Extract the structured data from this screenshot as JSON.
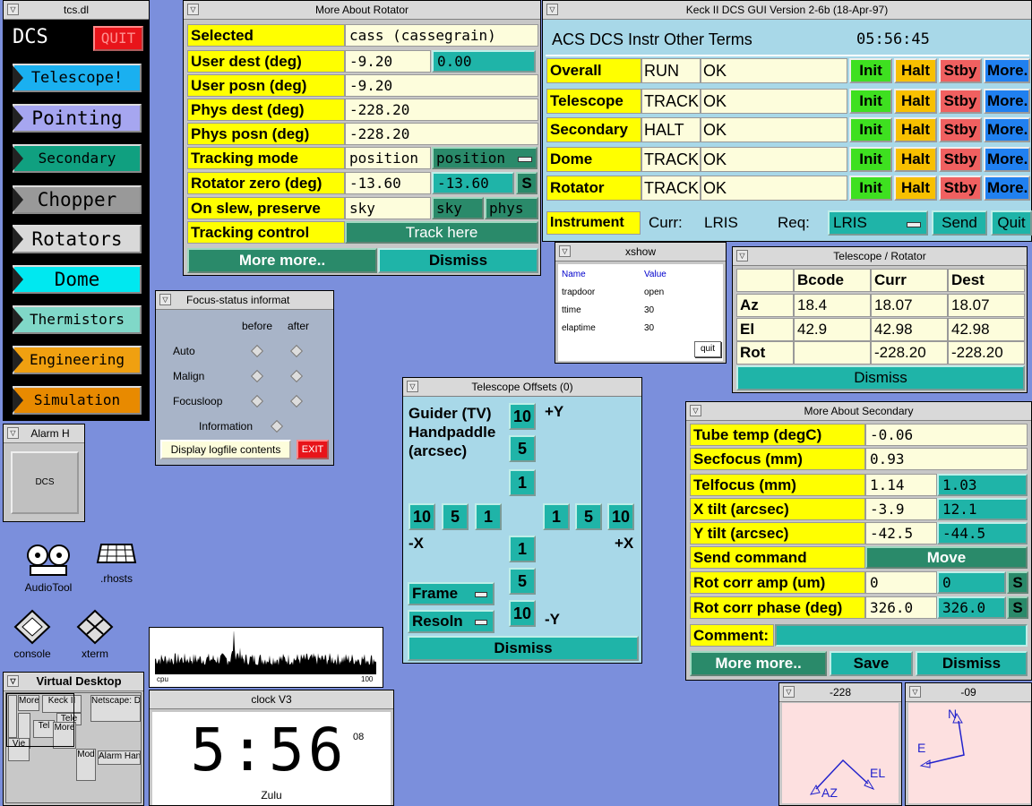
{
  "tcs": {
    "title": "tcs.dl",
    "dcs": "DCS",
    "quit": "QUIT",
    "buttons": [
      "Telescope!",
      "Pointing",
      "Secondary",
      "Chopper",
      "Rotators",
      "Dome",
      "Thermistors",
      "Engineering",
      "Simulation"
    ]
  },
  "alarm": {
    "title": "Alarm H",
    "label": "DCS"
  },
  "rotator": {
    "title": "More About Rotator",
    "selected_label": "Selected",
    "selected_value": "cass (cassegrain)",
    "user_dest_label": "User dest (deg)",
    "user_dest": "-9.20",
    "user_dest_input": "0.00",
    "user_posn_label": "User posn (deg)",
    "user_posn": "-9.20",
    "phys_dest_label": "Phys dest (deg)",
    "phys_dest": "-228.20",
    "phys_posn_label": "Phys posn (deg)",
    "phys_posn": "-228.20",
    "tracking_mode_label": "Tracking mode",
    "tracking_mode": "position",
    "tracking_mode_sel": "position",
    "rot_zero_label": "Rotator zero (deg)",
    "rot_zero": "-13.60",
    "rot_zero_input": "-13.60",
    "s": "S",
    "on_slew_label": "On slew, preserve",
    "on_slew": "sky",
    "sky": "sky",
    "phys": "phys",
    "tracking_control_label": "Tracking control",
    "track_here": "Track here",
    "more_more": "More more..",
    "dismiss": "Dismiss"
  },
  "keck": {
    "title": "Keck II DCS GUI Version 2-6b (18-Apr-97)",
    "menu": "ACS DCS Instr Other Terms",
    "time": "05:56:45",
    "rows": [
      {
        "name": "Overall",
        "state": "RUN",
        "status": "OK"
      },
      {
        "name": "Telescope",
        "state": "TRACK",
        "status": "OK"
      },
      {
        "name": "Secondary",
        "state": "HALT",
        "status": "OK"
      },
      {
        "name": "Dome",
        "state": "TRACK",
        "status": "OK"
      },
      {
        "name": "Rotator",
        "state": "TRACK",
        "status": "OK"
      }
    ],
    "init": "Init",
    "halt": "Halt",
    "stby": "Stby",
    "more": "More...",
    "instrument": "Instrument",
    "curr_label": "Curr:",
    "curr": "LRIS",
    "req_label": "Req:",
    "req": "LRIS",
    "send": "Send",
    "quit": "Quit"
  },
  "focus": {
    "title": "Focus-status informat",
    "before": "before",
    "after": "after",
    "rows": [
      "Auto",
      "Malign",
      "Focusloop"
    ],
    "information": "Information",
    "logfile": "Display logfile contents",
    "exit": "EXIT"
  },
  "xshow": {
    "title": "xshow",
    "col_name": "Name",
    "col_value": "Value",
    "rows": [
      {
        "name": "trapdoor",
        "value": "open"
      },
      {
        "name": "ttime",
        "value": "30"
      },
      {
        "name": "elaptime",
        "value": "30"
      }
    ],
    "quit": "quit"
  },
  "telrot": {
    "title": "Telescope / Rotator",
    "headers": [
      "Bcode",
      "Curr",
      "Dest"
    ],
    "rows": [
      {
        "name": "Az",
        "bcode": "18.4",
        "curr": "18.07",
        "dest": "18.07"
      },
      {
        "name": "El",
        "bcode": "42.9",
        "curr": "42.98",
        "dest": "42.98"
      },
      {
        "name": "Rot",
        "bcode": "",
        "curr": "-228.20",
        "dest": "-228.20"
      }
    ],
    "dismiss": "Dismiss"
  },
  "offsets": {
    "title": "Telescope Offsets (0)",
    "guider": "Guider (TV)",
    "handpaddle": "Handpaddle",
    "arcsec": "(arcsec)",
    "py": "+Y",
    "ny": "-Y",
    "px": "+X",
    "nx": "-X",
    "steps": [
      "10",
      "5",
      "1"
    ],
    "frame": "Frame",
    "resoln": "Resoln",
    "dismiss": "Dismiss"
  },
  "secondary": {
    "title": "More About Secondary",
    "tube_label": "Tube temp (degC)",
    "tube": "-0.06",
    "secfocus_label": "Secfocus (mm)",
    "secfocus": "0.93",
    "telfocus_label": "Telfocus (mm)",
    "telfocus": "1.14",
    "telfocus_input": "1.03",
    "xtilt_label": "X tilt (arcsec)",
    "xtilt": "-3.9",
    "xtilt_input": "12.1",
    "ytilt_label": "Y tilt (arcsec)",
    "ytilt": "-42.5",
    "ytilt_input": "-44.5",
    "send_label": "Send command",
    "move": "Move",
    "amp_label": "Rot corr amp (um)",
    "amp": "0",
    "amp_input": "0",
    "phase_label": "Rot corr phase (deg)",
    "phase": "326.0",
    "phase_input": "326.0",
    "s": "S",
    "comment_label": "Comment:",
    "more_more": "More more..",
    "save": "Save",
    "dismiss": "Dismiss"
  },
  "desktop": {
    "audiotool": "AudioTool",
    "rhosts": ".rhosts",
    "console": "console",
    "xterm": "xterm"
  },
  "vdesk": {
    "title": "Virtual Desktop",
    "thumbs": [
      "More",
      "Keck II",
      "Netscape: Di",
      "Tele",
      "Tel",
      "Mod",
      "Alarm Hand",
      "Mod",
      "Vie"
    ]
  },
  "cpu": {
    "left": "cpu",
    "right": "100"
  },
  "clock": {
    "title": "clock V3",
    "time": "5:56",
    "seconds": "08",
    "zone": "Zulu"
  },
  "rot228": {
    "title": "-228",
    "az": "AZ",
    "el": "EL"
  },
  "rot09": {
    "title": "-09",
    "n": "N",
    "e": "E"
  }
}
